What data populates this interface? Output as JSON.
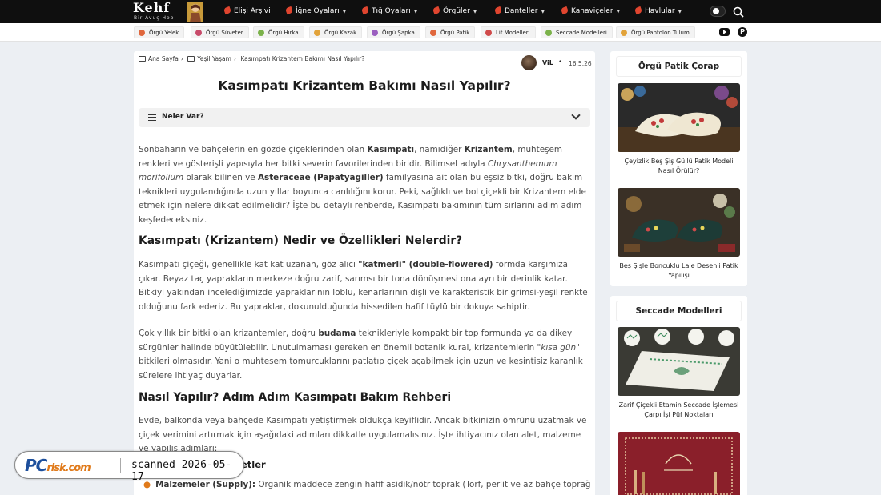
{
  "logo": {
    "line1": "Kehf",
    "line2": "Bir Avuç Hobi"
  },
  "topnav": [
    {
      "label": "Elişi Arşivi",
      "chevron": false
    },
    {
      "label": "İğne Oyaları",
      "chevron": true
    },
    {
      "label": "Tığ Oyaları",
      "chevron": true
    },
    {
      "label": "Örgüler",
      "chevron": true
    },
    {
      "label": "Danteller",
      "chevron": true
    },
    {
      "label": "Kanaviçeler",
      "chevron": true
    },
    {
      "label": "Havlular",
      "chevron": true
    }
  ],
  "subnav": [
    "Örgü Yelek",
    "Örgü Süveter",
    "Örgü Hırka",
    "Örgü Kazak",
    "Örgü Şapka",
    "Örgü Patik",
    "Lif Modelleri",
    "Seccade Modelleri",
    "Örgü Pantolon Tulum"
  ],
  "breadcrumb": {
    "home": "Ana Sayfa",
    "category": "Yeşil Yaşam",
    "current": "Kasımpatı Krizantem Bakımı Nasıl Yapılır?"
  },
  "author": {
    "name": "ViL",
    "date": "16.5.26"
  },
  "article": {
    "title": "Kasımpatı Krizantem Bakımı Nasıl Yapılır?",
    "toc_label": "Neler Var?",
    "p1": [
      {
        "t": "Sonbaharın ve bahçelerin en gözde çiçeklerinden olan "
      },
      {
        "t": "Kasımpatı",
        "b": true
      },
      {
        "t": ", namıdiğer "
      },
      {
        "t": "Krizantem",
        "b": true
      },
      {
        "t": ", muhteşem renkleri ve gösterişli yapısıyla her bitki severin favorilerinden biridir. Bilimsel adıyla "
      },
      {
        "t": "Chrysanthemum morifolium",
        "i": true
      },
      {
        "t": " olarak bilinen ve "
      },
      {
        "t": "Asteraceae (Papatyagiller)",
        "b": true
      },
      {
        "t": " familyasına ait olan bu eşsiz bitki, doğru bakım teknikleri uygulandığında uzun yıllar boyunca canlılığını korur. Peki, sağlıklı ve bol çiçekli bir Krizantem elde etmek için nelere dikkat edilmelidir? İşte bu detaylı rehberde, Kasımpatı bakımının tüm sırlarını adım adım keşfedeceksiniz."
      }
    ],
    "h2_1": "Kasımpatı (Krizantem) Nedir ve Özellikleri Nelerdir?",
    "p2": [
      {
        "t": "Kasımpatı çiçeği, genellikle kat kat uzanan, göz alıcı "
      },
      {
        "t": "\"katmerli\" (double-flowered)",
        "b": true
      },
      {
        "t": " formda karşımıza çıkar. Beyaz taç yaprakların merkeze doğru zarif, sarımsı bir tona dönüşmesi ona ayrı bir derinlik katar. Bitkiyi yakından incelediğimizde yapraklarının loblu, kenarlarının dişli ve karakteristik bir grimsi-yeşil renkte olduğunu fark ederiz. Bu yapraklar, dokunulduğunda hissedilen hafif tüylü bir dokuya sahiptir."
      }
    ],
    "p3": [
      {
        "t": "Çok yıllık bir bitki olan krizantemler, doğru "
      },
      {
        "t": "budama",
        "b": true
      },
      {
        "t": " teknikleriyle kompakt bir top formunda ya da dikey sürgünler halinde büyütülebilir. Unutulmaması gereken en önemli botanik kural, krizantemlerin "
      },
      {
        "t": "\"kısa gün\"",
        "i": true
      },
      {
        "t": " bitkileri olmasıdır. Yani o muhteşem tomurcuklarını patlatıp çiçek açabilmek için uzun ve kesintisiz karanlık sürelere ihtiyaç duyarlar."
      }
    ],
    "h2_2": "Nasıl Yapılır? Adım Adım Kasımpatı Bakım Rehberi",
    "p4": [
      {
        "t": "Evde, balkonda veya bahçede Kasımpatı yetiştirmek oldukça keyiflidir. Ancak bitkinizin ömrünü uzatmak ve çiçek verimini artırmak için aşağıdaki adımları dikkatle uygulamalısınız. İşte ihtiyacınız olan alet, malzeme ve yapılış adımları:"
      }
    ],
    "h3_1": "etler",
    "li1": [
      {
        "t": "Malzemeler (Supply):",
        "b": true
      },
      {
        "t": " Organik maddece zengin hafif asidik/nötr toprak (Torf, perlit ve az bahçe toprağı karışımı), Yüksek"
      }
    ]
  },
  "sidebar": [
    {
      "title": "Örgü Patik Çorap",
      "cards": [
        {
          "caption": "Çeyizlik Beş Şiş Güllü Patik Modeli Nasıl Örülür?"
        },
        {
          "caption": "Beş Şişle Boncuklu Lale Desenli Patik Yapılışı"
        }
      ]
    },
    {
      "title": "Seccade Modelleri",
      "cards": [
        {
          "caption": "Zarif Çiçekli Etamin Seccade İşlemesi Çarpı İşi Püf Noktaları"
        },
        {
          "caption": ""
        }
      ]
    }
  ],
  "watermark": {
    "logo_main": "PC",
    "logo_suffix": "risk.com",
    "text": "scanned 2026-05-17"
  }
}
